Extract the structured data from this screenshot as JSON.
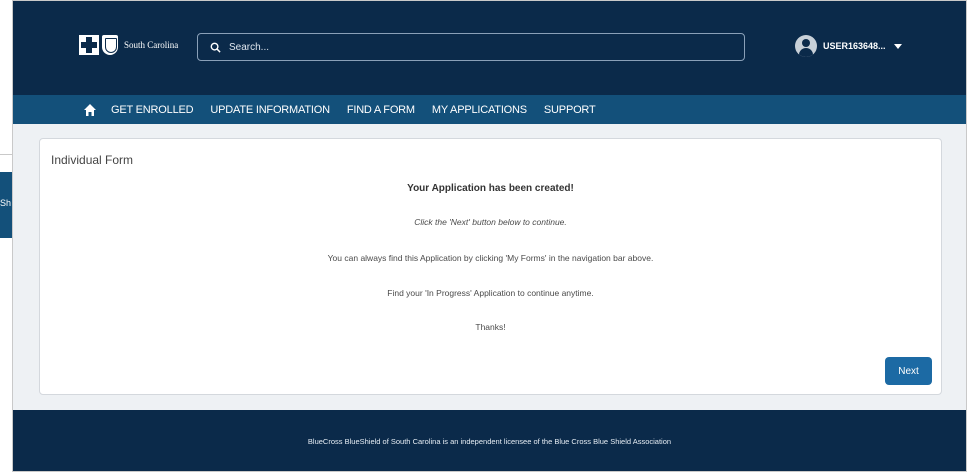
{
  "header": {
    "logo_text": "South Carolina",
    "search_placeholder": "Search...",
    "username": "USER163648..."
  },
  "nav": {
    "items": [
      "GET ENROLLED",
      "UPDATE INFORMATION",
      "FIND A FORM",
      "MY APPLICATIONS",
      "SUPPORT"
    ]
  },
  "side_tab": {
    "label": "Sh"
  },
  "card": {
    "title": "Individual Form",
    "heading": "Your Application has been created!",
    "line_1": "Click the 'Next' button below to continue.",
    "line_2": "You can always find this Application by clicking 'My Forms' in the navigation bar above.",
    "line_3": "Find your 'In Progress' Application to continue anytime.",
    "line_4": "Thanks!",
    "next_label": "Next"
  },
  "footer": {
    "text": "BlueCross BlueShield of South Carolina is an independent licensee of the Blue Cross Blue Shield Association"
  },
  "colors": {
    "header_bg": "#0b2a4a",
    "nav_bg": "#13507a",
    "button_bg": "#1c6aa4"
  }
}
